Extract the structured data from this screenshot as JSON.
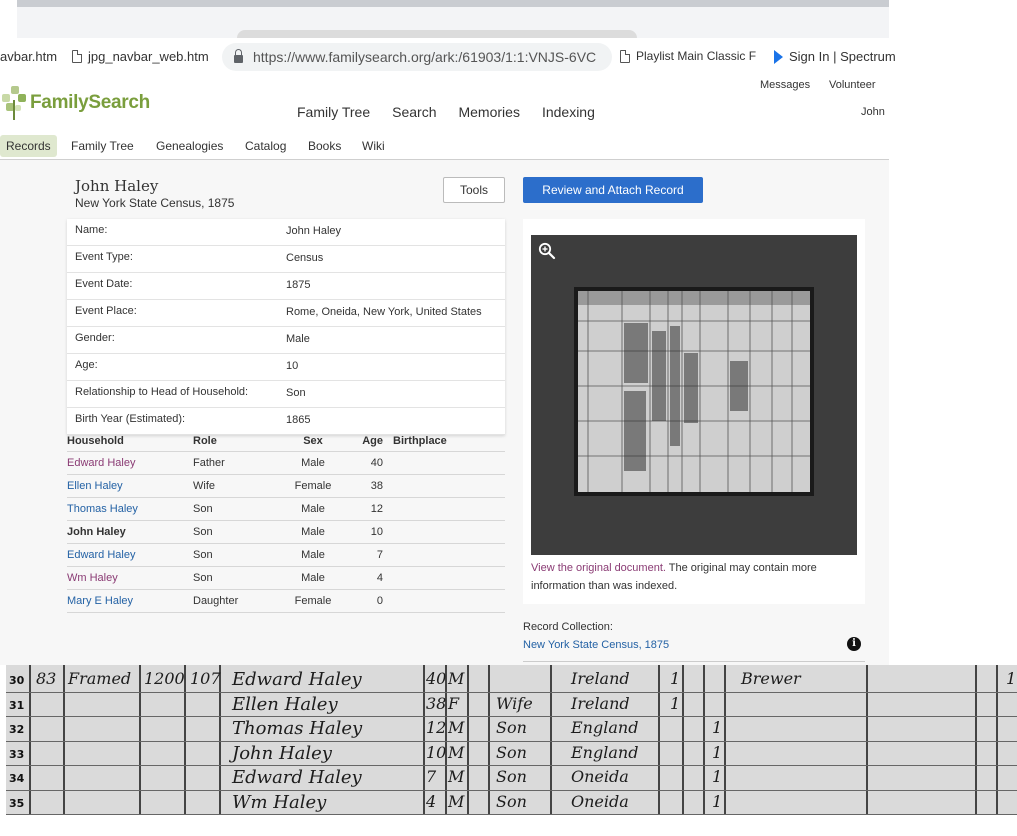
{
  "browser": {
    "bookmarks": [
      {
        "label": "avbar.htm",
        "icon": "none"
      },
      {
        "label": "jpg_navbar_web.htm",
        "icon": "doc-icon"
      },
      {
        "label": "Playlist Main Classic F",
        "icon": "doc-icon"
      },
      {
        "label": "Sign In | Spectrum",
        "icon": "play-icon"
      }
    ],
    "url": "https://www.familysearch.org/ark:/61903/1:1:VNJS-6VC"
  },
  "header": {
    "logo_text": "FamilySearch",
    "util_links": [
      "Messages",
      "Volunteer",
      "John"
    ],
    "main_nav": [
      "Family Tree",
      "Search",
      "Memories",
      "Indexing"
    ],
    "sub_nav": [
      "Records",
      "Family Tree",
      "Genealogies",
      "Catalog",
      "Books",
      "Wiki"
    ],
    "brand_color": "#7a9e3d"
  },
  "record": {
    "name": "John Haley",
    "collection": "New York State Census, 1875",
    "tools_label": "Tools",
    "review_label": "Review and Attach Record",
    "facts": [
      {
        "label": "Name:",
        "value": "John Haley"
      },
      {
        "label": "Event Type:",
        "value": "Census"
      },
      {
        "label": "Event Date:",
        "value": "1875"
      },
      {
        "label": "Event Place:",
        "value": "Rome, Oneida, New York, United States"
      },
      {
        "label": "Gender:",
        "value": "Male"
      },
      {
        "label": "Age:",
        "value": "10"
      },
      {
        "label": "Relationship to Head of Household:",
        "value": "Son"
      },
      {
        "label": "Birth Year (Estimated):",
        "value": "1865"
      }
    ],
    "household_headers": {
      "name": "Household",
      "role": "Role",
      "sex": "Sex",
      "age": "Age",
      "birthplace": "Birthplace"
    },
    "household": [
      {
        "name": "Edward Haley",
        "role": "Father",
        "sex": "Male",
        "age": "40",
        "birthplace": "",
        "color": "#8a3b74",
        "bold": false
      },
      {
        "name": "Ellen Haley",
        "role": "Wife",
        "sex": "Female",
        "age": "38",
        "birthplace": "",
        "color": "#2462a5",
        "bold": false
      },
      {
        "name": "Thomas Haley",
        "role": "Son",
        "sex": "Male",
        "age": "12",
        "birthplace": "",
        "color": "#2462a5",
        "bold": false
      },
      {
        "name": "John Haley",
        "role": "Son",
        "sex": "Male",
        "age": "10",
        "birthplace": "",
        "color": "#333333",
        "bold": true
      },
      {
        "name": "Edward Haley",
        "role": "Son",
        "sex": "Male",
        "age": "7",
        "birthplace": "",
        "color": "#2462a5",
        "bold": false
      },
      {
        "name": "Wm Haley",
        "role": "Son",
        "sex": "Male",
        "age": "4",
        "birthplace": "",
        "color": "#8a3b74",
        "bold": false
      },
      {
        "name": "Mary E Haley",
        "role": "Daughter",
        "sex": "Female",
        "age": "0",
        "birthplace": "",
        "color": "#2462a5",
        "bold": false
      }
    ],
    "viewer_link": "View the original document.",
    "viewer_note": " The original may contain more information than was indexed.",
    "record_collection_label": "Record Collection:",
    "record_collection_link": "New York State Census, 1875"
  },
  "census_image": {
    "rows": [
      {
        "num": "30",
        "cells": [
          "83",
          "Framed",
          "1200",
          "107",
          "Edward Haley",
          "40",
          "M",
          "",
          "Ireland",
          "1",
          "",
          "Brewer",
          "1"
        ]
      },
      {
        "num": "31",
        "cells": [
          "",
          "",
          "",
          "",
          "Ellen Haley",
          "38",
          "F",
          "Wife",
          "Ireland",
          "1",
          "",
          "",
          ""
        ]
      },
      {
        "num": "32",
        "cells": [
          "",
          "",
          "",
          "",
          "Thomas Haley",
          "12",
          "M",
          "Son",
          "England",
          "",
          "1",
          "",
          ""
        ]
      },
      {
        "num": "33",
        "cells": [
          "",
          "",
          "",
          "",
          "John Haley",
          "10",
          "M",
          "Son",
          "England",
          "",
          "1",
          "",
          ""
        ]
      },
      {
        "num": "34",
        "cells": [
          "",
          "",
          "",
          "",
          "Edward Haley",
          "7",
          "M",
          "Son",
          "Oneida",
          "",
          "1",
          "",
          ""
        ]
      },
      {
        "num": "35",
        "cells": [
          "",
          "",
          "",
          "",
          "Wm Haley",
          "4",
          "M",
          "Son",
          "Oneida",
          "",
          "1",
          "",
          ""
        ]
      }
    ]
  }
}
